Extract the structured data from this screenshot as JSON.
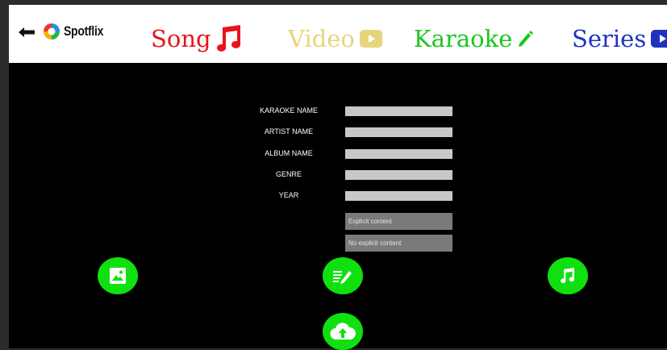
{
  "header": {
    "brand": "Spotflix",
    "nav": [
      {
        "label": "Song",
        "color": "#e8141c",
        "icon": "music-note-icon"
      },
      {
        "label": "Video",
        "color": "#e6d57a",
        "icon": "play-icon"
      },
      {
        "label": "Karaoke",
        "color": "#19c81a",
        "icon": "pencil-icon"
      },
      {
        "label": "Series",
        "color": "#1f31c2",
        "icon": "play-icon"
      }
    ]
  },
  "form": {
    "fields": [
      {
        "label": "KARAOKE NAME",
        "value": ""
      },
      {
        "label": "ARTIST NAME",
        "value": ""
      },
      {
        "label": "ALBUM NAME",
        "value": ""
      },
      {
        "label": "GENRE",
        "value": ""
      },
      {
        "label": "YEAR",
        "value": ""
      }
    ],
    "options": [
      "Explicit content",
      "No explicit content"
    ]
  },
  "actions": [
    {
      "name": "upload-image",
      "icon": "image-icon"
    },
    {
      "name": "upload-lyrics",
      "icon": "lyrics-edit-icon"
    },
    {
      "name": "upload-audio",
      "icon": "music-note-icon"
    },
    {
      "name": "upload-cloud",
      "icon": "cloud-upload-icon"
    }
  ],
  "colors": {
    "accent": "#10e010",
    "background": "#000000",
    "field": "#c8c8c8",
    "option": "#7a7a7a"
  }
}
